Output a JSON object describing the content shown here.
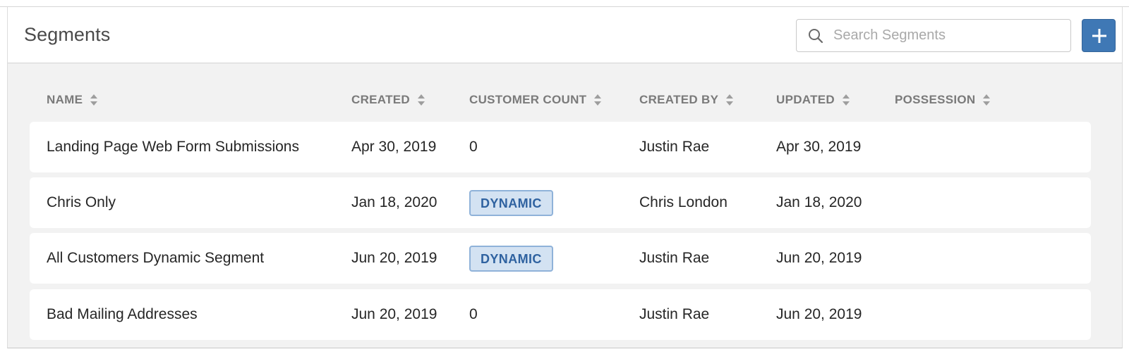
{
  "header": {
    "title": "Segments",
    "search_placeholder": "Search Segments",
    "search_value": ""
  },
  "columns": [
    "NAME",
    "CREATED",
    "CUSTOMER COUNT",
    "CREATED BY",
    "UPDATED",
    "POSSESSION"
  ],
  "rows": [
    {
      "name": "Landing Page Web Form Submissions",
      "created": "Apr 30, 2019",
      "customer_count": "0",
      "created_by": "Justin Rae",
      "updated": "Apr 30, 2019",
      "possession": ""
    },
    {
      "name": "Chris Only",
      "created": "Jan 18, 2020",
      "customer_count": "DYNAMIC",
      "created_by": "Chris London",
      "updated": "Jan 18, 2020",
      "possession": ""
    },
    {
      "name": "All Customers Dynamic Segment",
      "created": "Jun 20, 2019",
      "customer_count": "DYNAMIC",
      "created_by": "Justin Rae",
      "updated": "Jun 20, 2019",
      "possession": ""
    },
    {
      "name": "Bad Mailing Addresses",
      "created": "Jun 20, 2019",
      "customer_count": "0",
      "created_by": "Justin Rae",
      "updated": "Jun 20, 2019",
      "possession": ""
    }
  ],
  "icons": {
    "search": "search-icon",
    "add": "plus-icon",
    "sort": "sort-icon"
  },
  "colors": {
    "accent": "#3f78b5",
    "badge_bg": "#d3e2f2",
    "badge_text": "#2f62a0",
    "panel_bg": "#f2f2f2"
  }
}
